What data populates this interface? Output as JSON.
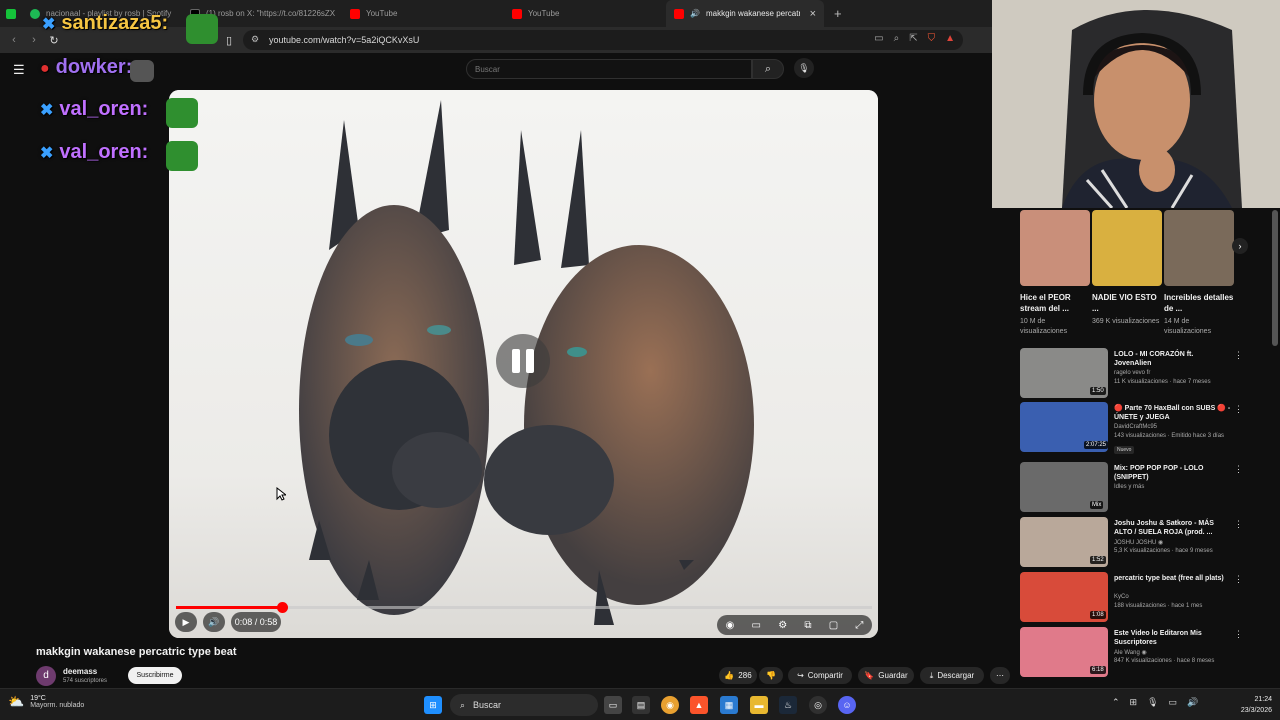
{
  "browser": {
    "tabs": [
      {
        "label": "nacionaal - playlist by rosb | Spotify",
        "color": "#1db954"
      },
      {
        "label": "(1) rosb on X: \"https://t.co/81226sZX",
        "color": "#ffffff"
      },
      {
        "label": "YouTube",
        "color": "#ff0000"
      },
      {
        "label": "YouTube",
        "color": "#ff0000"
      },
      {
        "label": "makkgin wakanese percatric t",
        "color": "#ff0000"
      }
    ],
    "close_glyph": "×",
    "new_tab_glyph": "+",
    "url": "youtube.com/watch?v=5a2iQCKvXsU"
  },
  "youtube": {
    "search_placeholder": "Buscar",
    "accent": "#ff0000"
  },
  "chat": [
    {
      "user": "santizaza5:",
      "color": "#f5c542"
    },
    {
      "user": "dowker:",
      "color": "#a070f0"
    },
    {
      "user": "val_oren:",
      "color": "#c070ff"
    },
    {
      "user": "val_oren:",
      "color": "#c070ff"
    }
  ],
  "player": {
    "time": "0:08 / 0:58",
    "progress": 0.152
  },
  "video": {
    "title": "makkgin wakanese percatric type beat",
    "channel": "deemass",
    "channel_initial": "d",
    "subscribers": "574 suscriptores",
    "subscribe_label": "Suscribirme",
    "likes": "286",
    "share_label": "Compartir",
    "save_label": "Guardar",
    "download_label": "Descargar"
  },
  "shorts": [
    {
      "title": "Hice el PEOR stream del ...",
      "views": "10 M de visualizaciones",
      "color": "#c98f7a"
    },
    {
      "title": "NADIE VIO ESTO ...",
      "views": "369 K visualizaciones",
      "color": "#d9b040"
    },
    {
      "title": "Increibles detalles de ...",
      "views": "14 M de visualizaciones",
      "color": "#7a6a5a"
    }
  ],
  "recommendations": [
    {
      "title": "LOLO - MI CORAZÓN ft. JovenAlien",
      "channel": "ragelo vevo fr",
      "meta": "11 K visualizaciones · hace 7 meses",
      "duration": "1:50",
      "color": "#8a8a88",
      "badge": ""
    },
    {
      "title": "🔴 Parte 70 HaxBall con SUBS 🔴 - ÚNETE y JUEGA",
      "channel": "DavidCraftMc95",
      "meta": "143 visualizaciones · Emitido hace 3 días",
      "duration": "2:07:25",
      "color": "#3a5fb0",
      "badge": "Nuevo"
    },
    {
      "title": "Mix: POP POP POP - LOLO (SNIPPET)",
      "channel": "Idles y más",
      "meta": "",
      "duration": "Mix",
      "color": "#6a6a6a",
      "badge": ""
    },
    {
      "title": "Joshu Joshu & Saŧkoro - MÁS ALTO / SUELA ROJA (prod. ...",
      "channel": "JOSHU JOSHU ◉",
      "meta": "5,3 K visualizaciones · hace 9 meses",
      "duration": "1:52",
      "color": "#b9a89a",
      "badge": ""
    },
    {
      "title": "percatric type beat (free all plats)",
      "channel": "KyCo",
      "meta": "188 visualizaciones · hace 1 mes",
      "duration": "1:08",
      "color": "#d84b3a",
      "badge": ""
    },
    {
      "title": "Este Video lo Editaron Mis Suscriptores",
      "channel": "Ale Wang ◉",
      "meta": "847 K visualizaciones · hace 8 meses",
      "duration": "6:18",
      "color": "#e07a8a",
      "badge": ""
    }
  ],
  "taskbar": {
    "temperature": "19°C",
    "weather": "Mayorm. nublado",
    "search_label": "Buscar",
    "time": "21:24",
    "date": "23/3/2026"
  }
}
